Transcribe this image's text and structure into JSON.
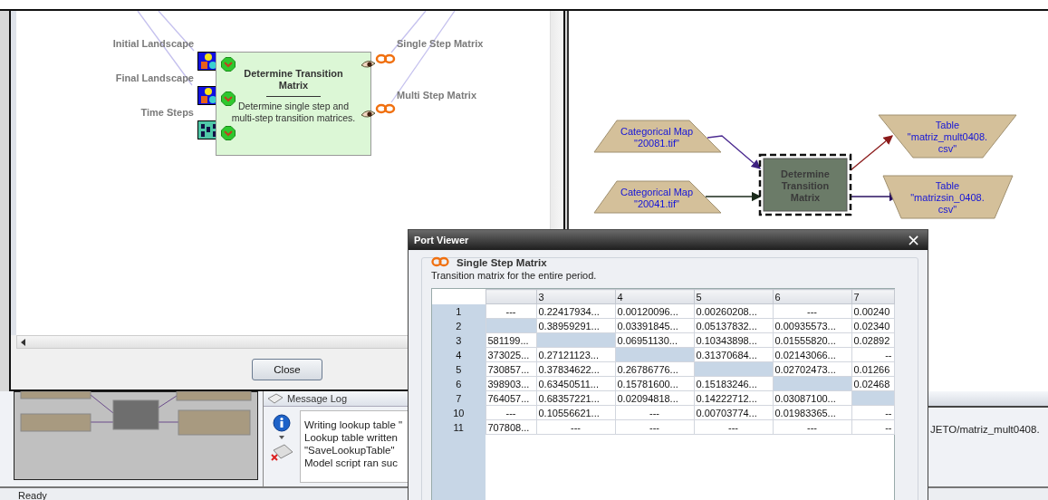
{
  "model_dialog": {
    "inputs": [
      {
        "label": "Initial Landscape",
        "kind": "map"
      },
      {
        "label": "Final Landscape",
        "kind": "map"
      },
      {
        "label": "Time Steps",
        "kind": "number"
      }
    ],
    "node": {
      "title": "Determine Transition Matrix",
      "description": "Determine single step and multi-step transition matrices."
    },
    "outputs": [
      {
        "label": "Single Step Matrix"
      },
      {
        "label": "Multi Step Matrix"
      }
    ],
    "close_button": "Close"
  },
  "diagram": {
    "inputs": [
      {
        "lines": [
          "Categorical Map",
          "\"20081.tif\""
        ]
      },
      {
        "lines": [
          "Categorical Map",
          "\"20041.tif\""
        ]
      }
    ],
    "process": {
      "lines": [
        "Determine",
        "Transition",
        "Matrix"
      ]
    },
    "outputs": [
      {
        "lines": [
          "Table",
          "\"matriz_mult0408.",
          "csv\""
        ]
      },
      {
        "lines": [
          "Table",
          "\"matrizsin_0408.",
          "csv\""
        ]
      }
    ]
  },
  "message_log": {
    "title": "Message Log",
    "lines": [
      "Writing lookup table \"",
      "Lookup table written",
      "\"SaveLookupTable\"",
      "Model script ran suc"
    ]
  },
  "output_path": "JETO/matriz_mult0408.",
  "status_bar": "Ready",
  "port_viewer": {
    "title": "Port Viewer",
    "close": "×",
    "port": "Single Step Matrix",
    "description": "Transition matrix for the entire period.",
    "columns": [
      "",
      "3",
      "4",
      "5",
      "6",
      "7"
    ],
    "rows": [
      {
        "label": "1",
        "cells": [
          {
            "kind": "none",
            "text": "---"
          },
          {
            "kind": "value",
            "text": "0.22417934..."
          },
          {
            "kind": "value",
            "text": "0.00120096..."
          },
          {
            "kind": "value",
            "text": "0.00260208..."
          },
          {
            "kind": "none",
            "text": "---"
          },
          {
            "kind": "value",
            "text": "0.00240"
          }
        ]
      },
      {
        "label": "2",
        "cells": [
          {
            "kind": "diagonal"
          },
          {
            "kind": "value",
            "text": "0.38959291..."
          },
          {
            "kind": "value",
            "text": "0.03391845..."
          },
          {
            "kind": "value",
            "text": "0.05137832..."
          },
          {
            "kind": "value",
            "text": "0.00935573..."
          },
          {
            "kind": "value",
            "text": "0.02340"
          }
        ]
      },
      {
        "label": "3",
        "cells": [
          {
            "kind": "value",
            "text": "581199..."
          },
          {
            "kind": "diagonal"
          },
          {
            "kind": "value",
            "text": "0.06951130..."
          },
          {
            "kind": "value",
            "text": "0.10343898..."
          },
          {
            "kind": "value",
            "text": "0.01555820..."
          },
          {
            "kind": "value",
            "text": "0.02892"
          }
        ]
      },
      {
        "label": "4",
        "cells": [
          {
            "kind": "value",
            "text": "373025..."
          },
          {
            "kind": "value",
            "text": "0.27121123..."
          },
          {
            "kind": "diagonal"
          },
          {
            "kind": "value",
            "text": "0.31370684..."
          },
          {
            "kind": "value",
            "text": "0.02143066..."
          },
          {
            "kind": "cut",
            "text": "--"
          }
        ]
      },
      {
        "label": "5",
        "cells": [
          {
            "kind": "value",
            "text": "730857..."
          },
          {
            "kind": "value",
            "text": "0.37834622..."
          },
          {
            "kind": "value",
            "text": "0.26786776..."
          },
          {
            "kind": "diagonal"
          },
          {
            "kind": "value",
            "text": "0.02702473..."
          },
          {
            "kind": "value",
            "text": "0.01266"
          }
        ]
      },
      {
        "label": "6",
        "cells": [
          {
            "kind": "value",
            "text": "398903..."
          },
          {
            "kind": "value",
            "text": "0.63450511..."
          },
          {
            "kind": "value",
            "text": "0.15781600..."
          },
          {
            "kind": "value",
            "text": "0.15183246..."
          },
          {
            "kind": "diagonal"
          },
          {
            "kind": "value",
            "text": "0.02468"
          }
        ]
      },
      {
        "label": "7",
        "cells": [
          {
            "kind": "value",
            "text": "764057..."
          },
          {
            "kind": "value",
            "text": "0.68357221..."
          },
          {
            "kind": "value",
            "text": "0.02094818..."
          },
          {
            "kind": "value",
            "text": "0.14222712..."
          },
          {
            "kind": "value",
            "text": "0.03087100..."
          },
          {
            "kind": "diagonal"
          }
        ]
      },
      {
        "label": "10",
        "cells": [
          {
            "kind": "none",
            "text": "---"
          },
          {
            "kind": "value",
            "text": "0.10556621..."
          },
          {
            "kind": "none",
            "text": "---"
          },
          {
            "kind": "value",
            "text": "0.00703774..."
          },
          {
            "kind": "value",
            "text": "0.01983365..."
          },
          {
            "kind": "cut",
            "text": "--"
          }
        ]
      },
      {
        "label": "11",
        "cells": [
          {
            "kind": "value",
            "text": "707808..."
          },
          {
            "kind": "none",
            "text": "---"
          },
          {
            "kind": "none",
            "text": "---"
          },
          {
            "kind": "none",
            "text": "---"
          },
          {
            "kind": "none",
            "text": "---"
          },
          {
            "kind": "cut",
            "text": "--"
          }
        ]
      }
    ]
  }
}
